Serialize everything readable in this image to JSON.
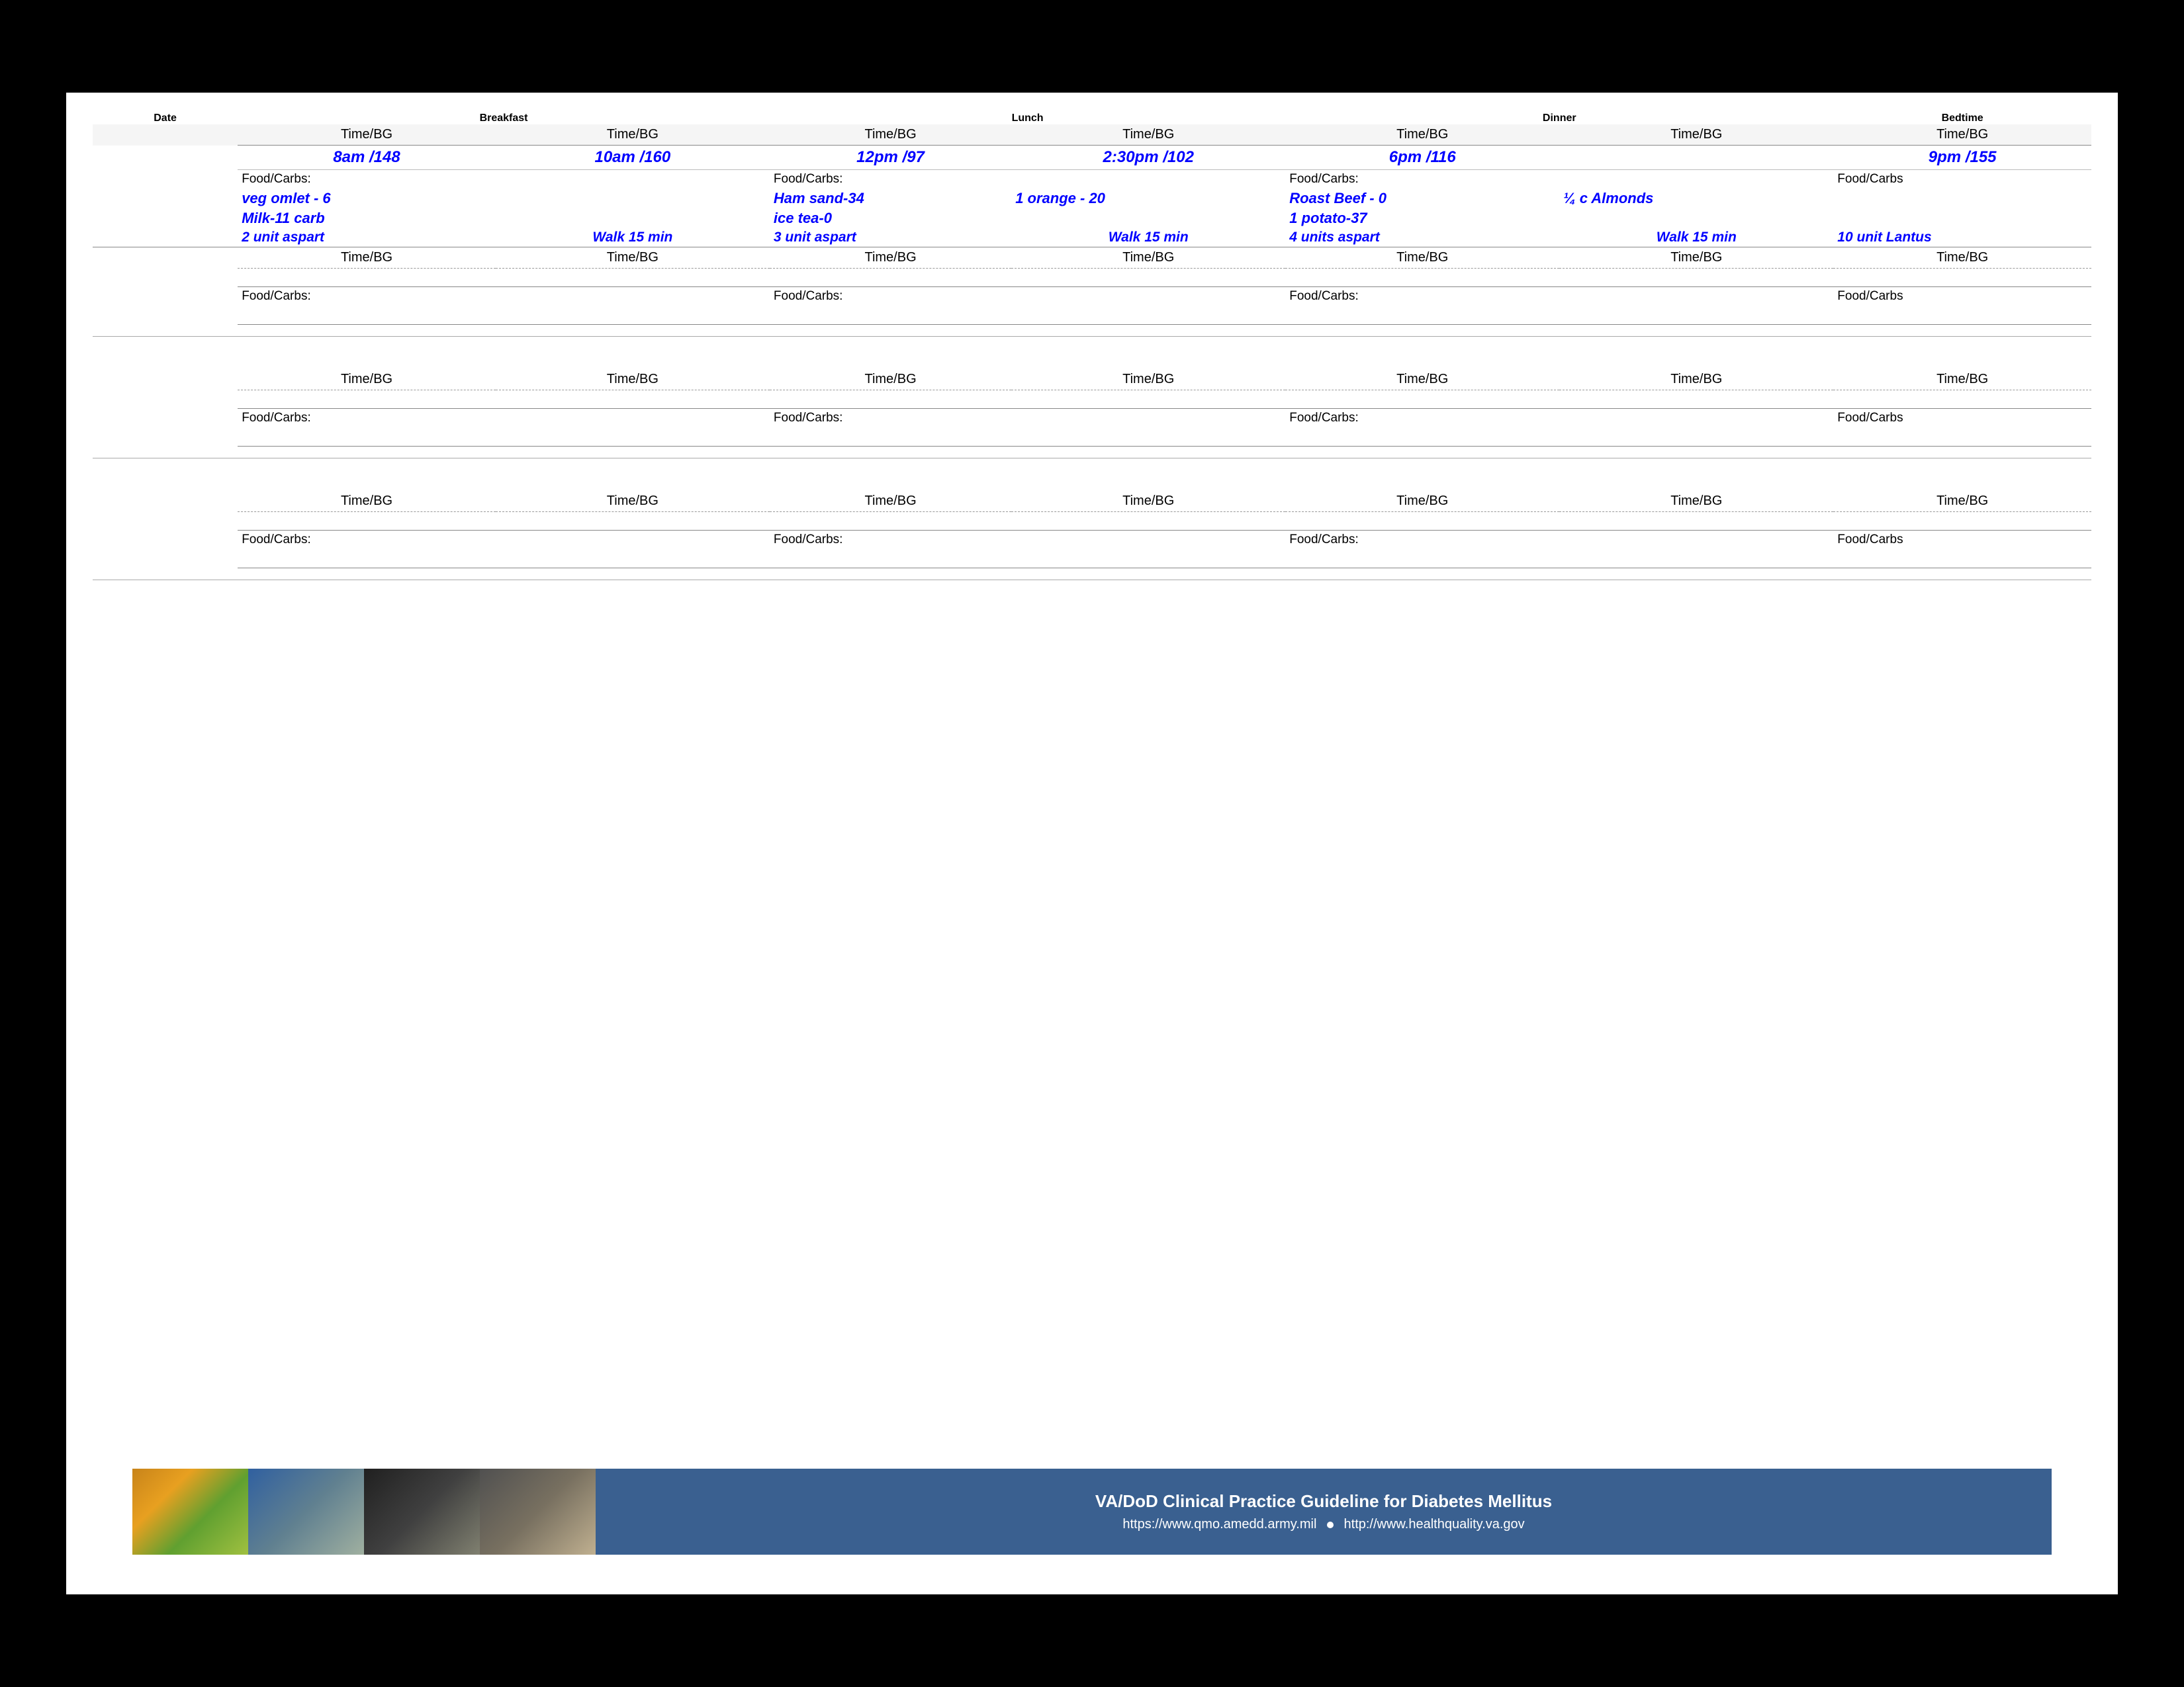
{
  "header": {
    "date_label": "Date",
    "breakfast_label": "Breakfast",
    "lunch_label": "Lunch",
    "dinner_label": "Dinner",
    "bedtime_label": "Bedtime"
  },
  "subheaders": {
    "time_bg": "Time/BG",
    "food_carbs": "Food/Carbs:",
    "food_carbs_no_colon": "Food/Carbs"
  },
  "row1": {
    "times": [
      "8am /148",
      "10am /160",
      "12pm /97",
      "2:30pm /102",
      "6pm /116",
      "",
      "9pm /155"
    ],
    "food_items": [
      [
        "veg omlet - 6",
        "Milk-11 carb",
        "2 unit aspart"
      ],
      [
        "Walk 15 min"
      ],
      [
        "Ham sand-34",
        "ice tea-0",
        "3 unit aspart"
      ],
      [
        "Walk 15 min",
        "1 orange - 20"
      ],
      [
        "Roast Beef - 0",
        "1 potato-37",
        "4 units aspart"
      ],
      [
        "Walk 15 min",
        "¼ c Almonds"
      ],
      [
        "10 unit Lantus"
      ]
    ]
  },
  "footer": {
    "title": "VA/DoD Clinical Practice Guideline for Diabetes Mellitus",
    "url1": "https://www.qmo.amedd.army.mil",
    "separator": "●",
    "url2": "http://www.healthquality.va.gov"
  }
}
